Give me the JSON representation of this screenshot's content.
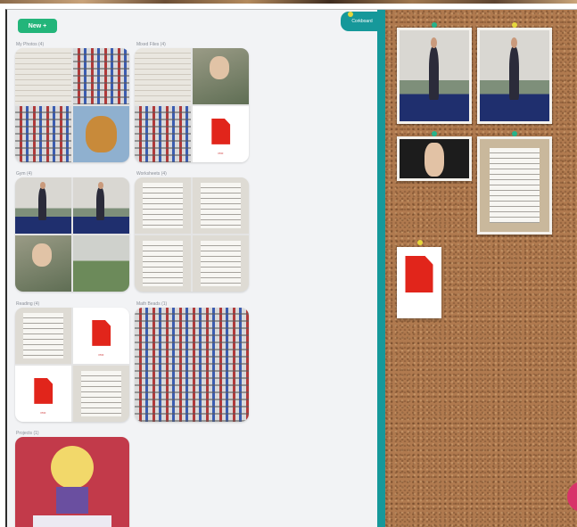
{
  "toolbar": {
    "new_label": "New +"
  },
  "groups": [
    {
      "label": "My Photos (4)"
    },
    {
      "label": "Mixed Files (4)"
    },
    {
      "label": "Gym (4)"
    },
    {
      "label": "Worksheets (4)"
    },
    {
      "label": "Reading (4)"
    },
    {
      "label": "Math Beads (1)"
    },
    {
      "label": "Projects (1)"
    }
  ],
  "pdf_caption": "PDF",
  "board": {
    "tab_label": "Corkboard",
    "accent": "#16989a"
  },
  "colors": {
    "new_button": "#23b57a",
    "pdf_red": "#e1251b",
    "cork": "#b07a4f"
  }
}
